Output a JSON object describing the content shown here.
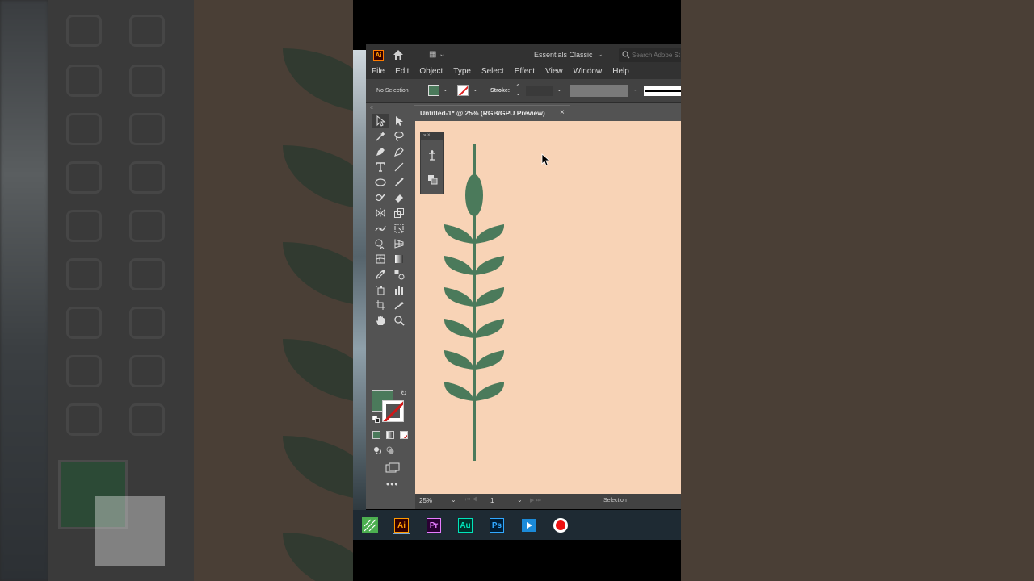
{
  "app": {
    "logo_text": "Ai",
    "workspace": "Essentials Classic",
    "search_placeholder": "Search Adobe Stock"
  },
  "menu": [
    "File",
    "Edit",
    "Object",
    "Type",
    "Select",
    "Effect",
    "View",
    "Window",
    "Help"
  ],
  "control_bar": {
    "selection_label": "No Selection",
    "stroke_label": "Stroke:",
    "fill_color": "#4b7a5b"
  },
  "document": {
    "tab_label": "Untitled-1* @ 25% (RGB/GPU Preview)",
    "canvas_color": "#f8d3b6",
    "art_color": "#4b7a5b"
  },
  "status_bar": {
    "zoom": "25%",
    "page": "1",
    "tool": "Selection"
  },
  "taskbar": [
    {
      "name": "Corel",
      "letters": "",
      "bg": "#4caf50",
      "fg": "#ffffff"
    },
    {
      "name": "Illustrator",
      "letters": "Ai",
      "bg": "#330000",
      "fg": "#ff9a00"
    },
    {
      "name": "Premiere Pro",
      "letters": "Pr",
      "bg": "#2a0033",
      "fg": "#e77cff"
    },
    {
      "name": "Audition",
      "letters": "Au",
      "bg": "#00332c",
      "fg": "#00e4bb"
    },
    {
      "name": "Photoshop",
      "letters": "Ps",
      "bg": "#001e36",
      "fg": "#31a8ff"
    },
    {
      "name": "Movie Player",
      "letters": "",
      "bg": "#1b8ad8",
      "fg": "#ffffff"
    },
    {
      "name": "Recorder",
      "letters": "",
      "bg": "#ffffff",
      "fg": "#e11"
    }
  ]
}
